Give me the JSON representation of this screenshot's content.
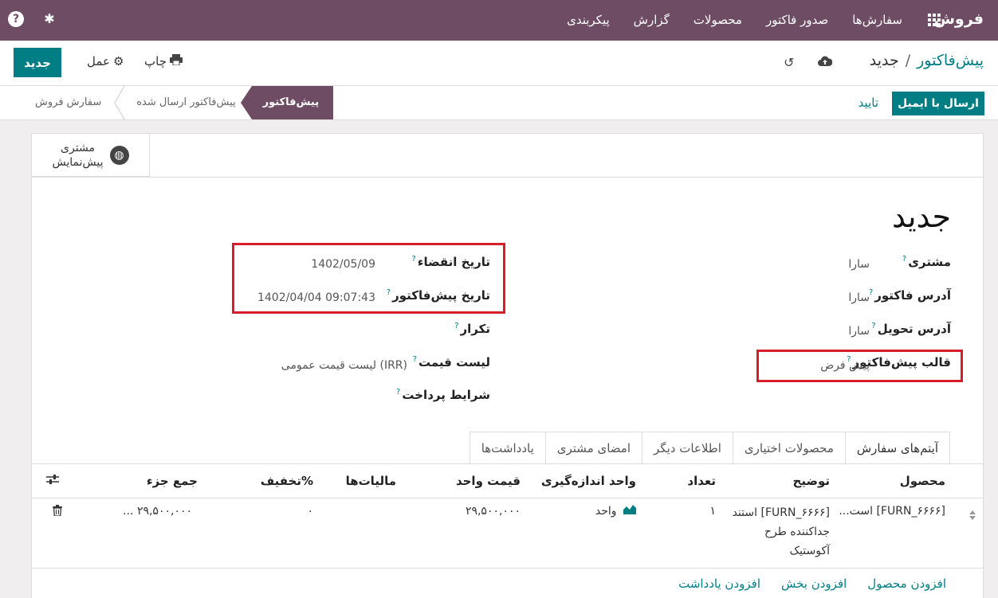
{
  "topbar": {
    "brand": "فروش",
    "menu": [
      "سفارش‌ها",
      "صدور فاکتور",
      "محصولات",
      "گزارش",
      "پیکربندی"
    ],
    "help_icon": "?",
    "bug_icon": "✱"
  },
  "control": {
    "new_label": "جدید",
    "action_label": "عمل",
    "print_label": "چاپ",
    "breadcrumb_parent": "پیش‌فاکتور",
    "breadcrumb_sep": "/",
    "breadcrumb_current": "جدید"
  },
  "status": {
    "send_email_label": "ارسال با ایمیل",
    "confirm_label": "تایید",
    "stages": [
      "پیش‌فاکتور",
      "پیش‌فاکتور ارسال شده",
      "سفارش فروش"
    ],
    "active_stage": 0
  },
  "smart_button": {
    "line1": "مشتری",
    "line2": "پیش‌نمایش"
  },
  "form": {
    "title": "جدید",
    "left_fields": [
      {
        "label": "مشتری",
        "value": "سارا"
      },
      {
        "label": "آدرس فاکتور",
        "value": "سارا"
      },
      {
        "label": "آدرس تحویل",
        "value": "سارا"
      },
      {
        "label": "قالب پیش‌فاکتور",
        "value": "پیش فرض"
      }
    ],
    "right_fields": [
      {
        "label": "تاریخ انقضاء",
        "value": "1402/05/09"
      },
      {
        "label": "تاریخ پیش‌فاکتور",
        "value": "1402/04/04 09:07:43"
      },
      {
        "label": "تکرار",
        "value": ""
      },
      {
        "label": "لیست قیمت",
        "value": "لیست قیمت عمومی (IRR)"
      },
      {
        "label": "شرایط پرداخت",
        "value": ""
      }
    ],
    "help_mark": "?"
  },
  "tabs": [
    "آیتم‌های سفارش",
    "محصولات اختیاری",
    "اطلاعات دیگر",
    "امضای مشتری",
    "یادداشت‌ها"
  ],
  "table": {
    "headers": {
      "product": "محصول",
      "description": "توضیح",
      "qty": "تعداد",
      "uom": "واحد اندازه‌گیری",
      "price": "قیمت واحد",
      "taxes": "مالیات‌ها",
      "discount": "تخفیف%",
      "subtotal": "جمع جزء"
    },
    "row": {
      "product": "[FURN_۶۶۶۶] است...",
      "desc_line1": "[FURN_۶۶۶۶] استند",
      "desc_line2": "جداکننده طرح",
      "desc_line3": "آکوستیک",
      "qty": "۱",
      "uom": "واحد",
      "price": "۲۹,۵۰۰,۰۰۰",
      "discount": "۰",
      "subtotal": "۲۹,۵۰۰,۰۰۰ ..."
    },
    "add_links": [
      "افزودن محصول",
      "افزودن بخش",
      "افزودن یادداشت"
    ]
  }
}
